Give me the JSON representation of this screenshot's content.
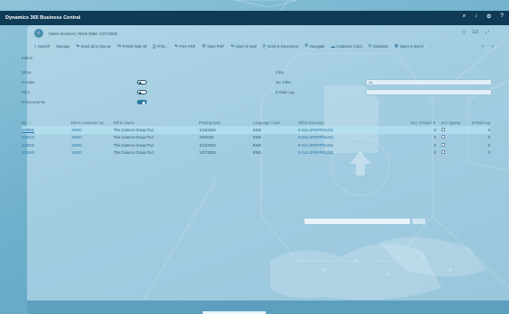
{
  "app": {
    "title": "Dynamics 365 Business Central",
    "top_icons": [
      "search-icon",
      "bell-icon",
      "gear-icon",
      "help-icon"
    ]
  },
  "page": {
    "breadcrumb": "Sales Invoices | Work Date: 1/27/2022",
    "header_right": [
      "▯",
      "1/2",
      "⤢"
    ]
  },
  "toolbar": {
    "items": [
      {
        "icon": "⌕",
        "label": "Search"
      },
      {
        "icon": "",
        "label": "Manage"
      },
      {
        "icon": "⇆",
        "label": "Send all to Queue"
      },
      {
        "icon": "⇆",
        "label": "Print/E-Mail all"
      },
      {
        "icon": "⎙",
        "label": "Print..."
      },
      {
        "icon": "⇆",
        "label": "Print PDF"
      },
      {
        "icon": "▤",
        "label": "Save PDF"
      },
      {
        "icon": "⇆",
        "label": "Open E-Mail"
      },
      {
        "icon": "⎘",
        "label": "Send E-Document"
      },
      {
        "icon": "⌘",
        "label": "Navigate"
      },
      {
        "icon": "▬",
        "label": "Customer Card"
      },
      {
        "icon": "⊡",
        "label": "Statistics"
      },
      {
        "icon": "▦",
        "label": "Open in Excel"
      },
      {
        "icon": "",
        "label": "···"
      }
    ],
    "right_icons": [
      "▽",
      "≡"
    ]
  },
  "filters": {
    "title": "Filters",
    "show_label": "Show",
    "left": [
      {
        "label": "E-Mails",
        "on": false
      },
      {
        "label": "Print",
        "on": false
      },
      {
        "label": "E-Documents",
        "on": true
      }
    ],
    "right_title": "Filter",
    "right": [
      {
        "label": "No. Filter",
        "value": "10"
      },
      {
        "label": "E-Mail Log",
        "value": ""
      }
    ]
  },
  "table": {
    "columns": [
      "No. ↑",
      "Bill-to Customer No.",
      "Bill-to Name",
      "Posting Date",
      "Language Code",
      "Office Directory",
      "Doc. Printed ▼",
      "Is in Queue",
      "E-Mail Log"
    ],
    "rows": [
      {
        "no": "103001",
        "cust": "10000",
        "name": "The Cannon Group PLC",
        "date": "1/24/2022",
        "lang": "ENG",
        "office": "E-Doc.ZPEPPOL001",
        "printed": "0",
        "queue": "",
        "log": "0",
        "selected": true
      },
      {
        "no": "103015",
        "cust": "10000",
        "name": "The Cannon Group PLC",
        "date": "1/5/2022",
        "lang": "ENG",
        "office": "E-Doc.ZPEPPOL001",
        "printed": "0",
        "queue": "",
        "log": "0",
        "selected": false
      },
      {
        "no": "103030",
        "cust": "10000",
        "name": "The Cannon Group PLC",
        "date": "1/13/2022",
        "lang": "ENG",
        "office": "E-Doc.ZPEPPOL001",
        "printed": "0",
        "queue": "",
        "log": "0",
        "selected": false
      },
      {
        "no": "103040",
        "cust": "10000",
        "name": "The Cannon Group PLC",
        "date": "1/27/2022",
        "lang": "ENG",
        "office": "E-Doc.ZPEPPOL001",
        "printed": "0",
        "queue": "",
        "log": "0",
        "selected": false
      }
    ]
  }
}
